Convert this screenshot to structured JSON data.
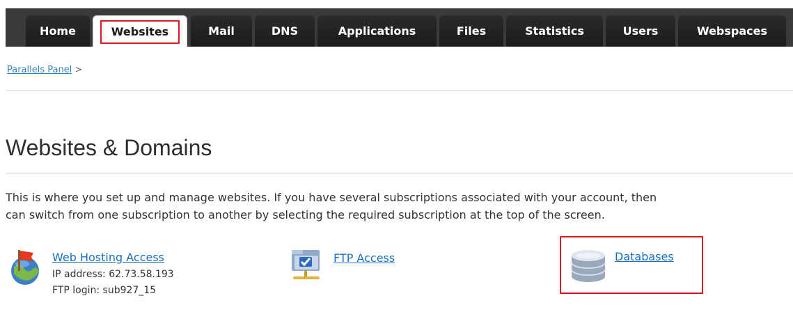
{
  "nav": {
    "tabs": [
      {
        "label": "Home"
      },
      {
        "label": "Websites"
      },
      {
        "label": "Mail"
      },
      {
        "label": "DNS"
      },
      {
        "label": "Applications"
      },
      {
        "label": "Files"
      },
      {
        "label": "Statistics"
      },
      {
        "label": "Users"
      },
      {
        "label": "Webspaces"
      }
    ],
    "active": "Websites"
  },
  "breadcrumb": {
    "link": "Parallels Panel",
    "separator": ">"
  },
  "page": {
    "title": "Websites & Domains",
    "description_line1": "This is where you set up and manage websites. If you have several subscriptions associated with your account, then",
    "description_line2": "can switch from one subscription to another by selecting the required subscription at the top of the screen."
  },
  "tools": {
    "web_hosting": {
      "label": "Web Hosting Access",
      "ip": "IP address: 62.73.58.193",
      "ftp_login": "FTP login: sub927_15",
      "icon": "globe-flag-icon"
    },
    "ftp": {
      "label": "FTP Access",
      "icon": "ftp-folder-icon"
    },
    "databases": {
      "label": "Databases",
      "icon": "database-icon"
    }
  },
  "colors": {
    "highlight": "#d81b22",
    "link": "#1b6fc2",
    "tabbar": "#2b2b2b"
  }
}
